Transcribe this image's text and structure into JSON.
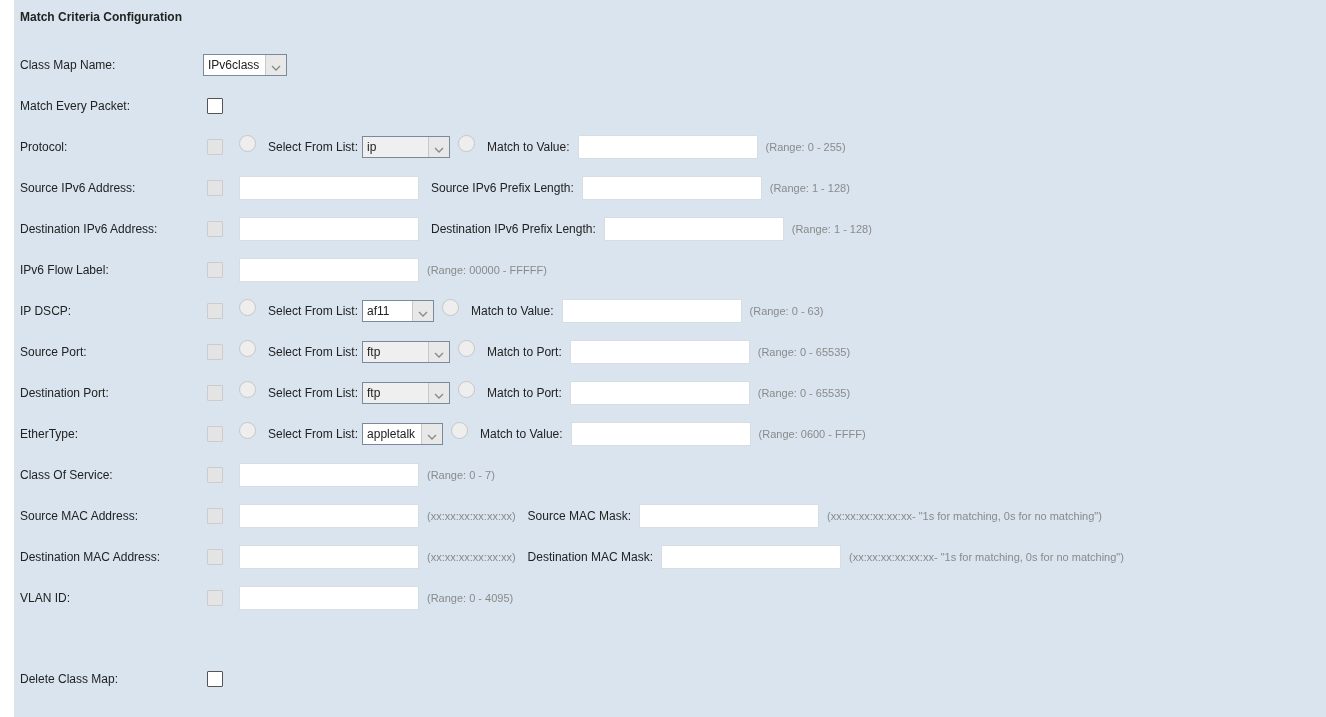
{
  "title": "Match Criteria Configuration",
  "rows": [
    {
      "label": "Class Map Name:",
      "parts": [
        {
          "kind": "select",
          "value": "IPv6class",
          "disabled": false
        }
      ]
    },
    {
      "label": "Match Every Packet:",
      "parts": [
        {
          "kind": "checkbox",
          "checked": false,
          "disabled": false
        }
      ]
    },
    {
      "label": "Protocol:",
      "parts": [
        {
          "kind": "checkbox",
          "checked": false,
          "disabled": true
        },
        {
          "kind": "radio",
          "selected": false,
          "disabled": true
        },
        {
          "kind": "text",
          "text": "Select From List:"
        },
        {
          "kind": "select",
          "value": "ip",
          "disabled": true
        },
        {
          "kind": "radio",
          "selected": false,
          "disabled": true
        },
        {
          "kind": "text",
          "text": "Match to Value:"
        },
        {
          "kind": "input"
        },
        {
          "kind": "hint",
          "text": "(Range: 0 - 255)"
        }
      ]
    },
    {
      "label": "Source IPv6 Address:",
      "parts": [
        {
          "kind": "checkbox",
          "checked": false,
          "disabled": true
        },
        {
          "kind": "input"
        },
        {
          "kind": "text",
          "text": "Source IPv6 Prefix Length:"
        },
        {
          "kind": "input"
        },
        {
          "kind": "hint",
          "text": "(Range: 1 - 128)"
        }
      ]
    },
    {
      "label": "Destination IPv6 Address:",
      "parts": [
        {
          "kind": "checkbox",
          "checked": false,
          "disabled": true
        },
        {
          "kind": "input"
        },
        {
          "kind": "text",
          "text": "Destination IPv6 Prefix Length:"
        },
        {
          "kind": "input"
        },
        {
          "kind": "hint",
          "text": "(Range: 1 - 128)"
        }
      ]
    },
    {
      "label": "IPv6 Flow Label:",
      "parts": [
        {
          "kind": "checkbox",
          "checked": false,
          "disabled": true
        },
        {
          "kind": "input"
        },
        {
          "kind": "hint",
          "text": "(Range: 00000 - FFFFF)"
        }
      ]
    },
    {
      "label": "IP DSCP:",
      "parts": [
        {
          "kind": "checkbox",
          "checked": false,
          "disabled": true
        },
        {
          "kind": "radio",
          "selected": false,
          "disabled": true
        },
        {
          "kind": "text",
          "text": "Select From List:"
        },
        {
          "kind": "select",
          "value": "af11",
          "disabled": false
        },
        {
          "kind": "radio",
          "selected": false,
          "disabled": true
        },
        {
          "kind": "text",
          "text": "Match to Value:"
        },
        {
          "kind": "input"
        },
        {
          "kind": "hint",
          "text": "(Range: 0 - 63)"
        }
      ]
    },
    {
      "label": "Source Port:",
      "parts": [
        {
          "kind": "checkbox",
          "checked": false,
          "disabled": true
        },
        {
          "kind": "radio",
          "selected": false,
          "disabled": true
        },
        {
          "kind": "text",
          "text": "Select From List:"
        },
        {
          "kind": "select",
          "value": "ftp",
          "disabled": true
        },
        {
          "kind": "radio",
          "selected": false,
          "disabled": true
        },
        {
          "kind": "text",
          "text": "Match to Port:"
        },
        {
          "kind": "input"
        },
        {
          "kind": "hint",
          "text": "(Range: 0 - 65535)"
        }
      ]
    },
    {
      "label": "Destination Port:",
      "parts": [
        {
          "kind": "checkbox",
          "checked": false,
          "disabled": true
        },
        {
          "kind": "radio",
          "selected": false,
          "disabled": true
        },
        {
          "kind": "text",
          "text": "Select From List:"
        },
        {
          "kind": "select",
          "value": "ftp",
          "disabled": true
        },
        {
          "kind": "radio",
          "selected": false,
          "disabled": true
        },
        {
          "kind": "text",
          "text": "Match to Port:"
        },
        {
          "kind": "input"
        },
        {
          "kind": "hint",
          "text": "(Range: 0 - 65535)"
        }
      ]
    },
    {
      "label": "EtherType:",
      "parts": [
        {
          "kind": "checkbox",
          "checked": false,
          "disabled": true
        },
        {
          "kind": "radio",
          "selected": false,
          "disabled": true
        },
        {
          "kind": "text",
          "text": "Select From List:"
        },
        {
          "kind": "select",
          "value": "appletalk",
          "disabled": false
        },
        {
          "kind": "radio",
          "selected": false,
          "disabled": true
        },
        {
          "kind": "text",
          "text": "Match to Value:"
        },
        {
          "kind": "input"
        },
        {
          "kind": "hint",
          "text": "(Range: 0600 - FFFF)"
        }
      ]
    },
    {
      "label": "Class Of Service:",
      "parts": [
        {
          "kind": "checkbox",
          "checked": false,
          "disabled": true
        },
        {
          "kind": "input"
        },
        {
          "kind": "hint",
          "text": "(Range: 0 - 7)"
        }
      ]
    },
    {
      "label": "Source MAC Address:",
      "parts": [
        {
          "kind": "checkbox",
          "checked": false,
          "disabled": true
        },
        {
          "kind": "input"
        },
        {
          "kind": "hint",
          "text": "(xx:xx:xx:xx:xx:xx)"
        },
        {
          "kind": "text",
          "text": "Source MAC Mask:"
        },
        {
          "kind": "input"
        },
        {
          "kind": "hint",
          "text": "(xx:xx:xx:xx:xx:xx- \"1s for matching, 0s for no matching\")"
        }
      ]
    },
    {
      "label": "Destination MAC Address:",
      "parts": [
        {
          "kind": "checkbox",
          "checked": false,
          "disabled": true
        },
        {
          "kind": "input"
        },
        {
          "kind": "hint",
          "text": "(xx:xx:xx:xx:xx:xx)"
        },
        {
          "kind": "text",
          "text": "Destination MAC Mask:"
        },
        {
          "kind": "input"
        },
        {
          "kind": "hint",
          "text": "(xx:xx:xx:xx:xx:xx- \"1s for matching, 0s for no matching\")"
        }
      ]
    },
    {
      "label": "VLAN ID:",
      "parts": [
        {
          "kind": "checkbox",
          "checked": false,
          "disabled": true
        },
        {
          "kind": "input"
        },
        {
          "kind": "hint",
          "text": "(Range: 0 - 4095)"
        }
      ]
    }
  ],
  "delete_row": {
    "label": "Delete Class Map:",
    "parts": [
      {
        "kind": "checkbox",
        "checked": false,
        "disabled": false
      }
    ]
  }
}
